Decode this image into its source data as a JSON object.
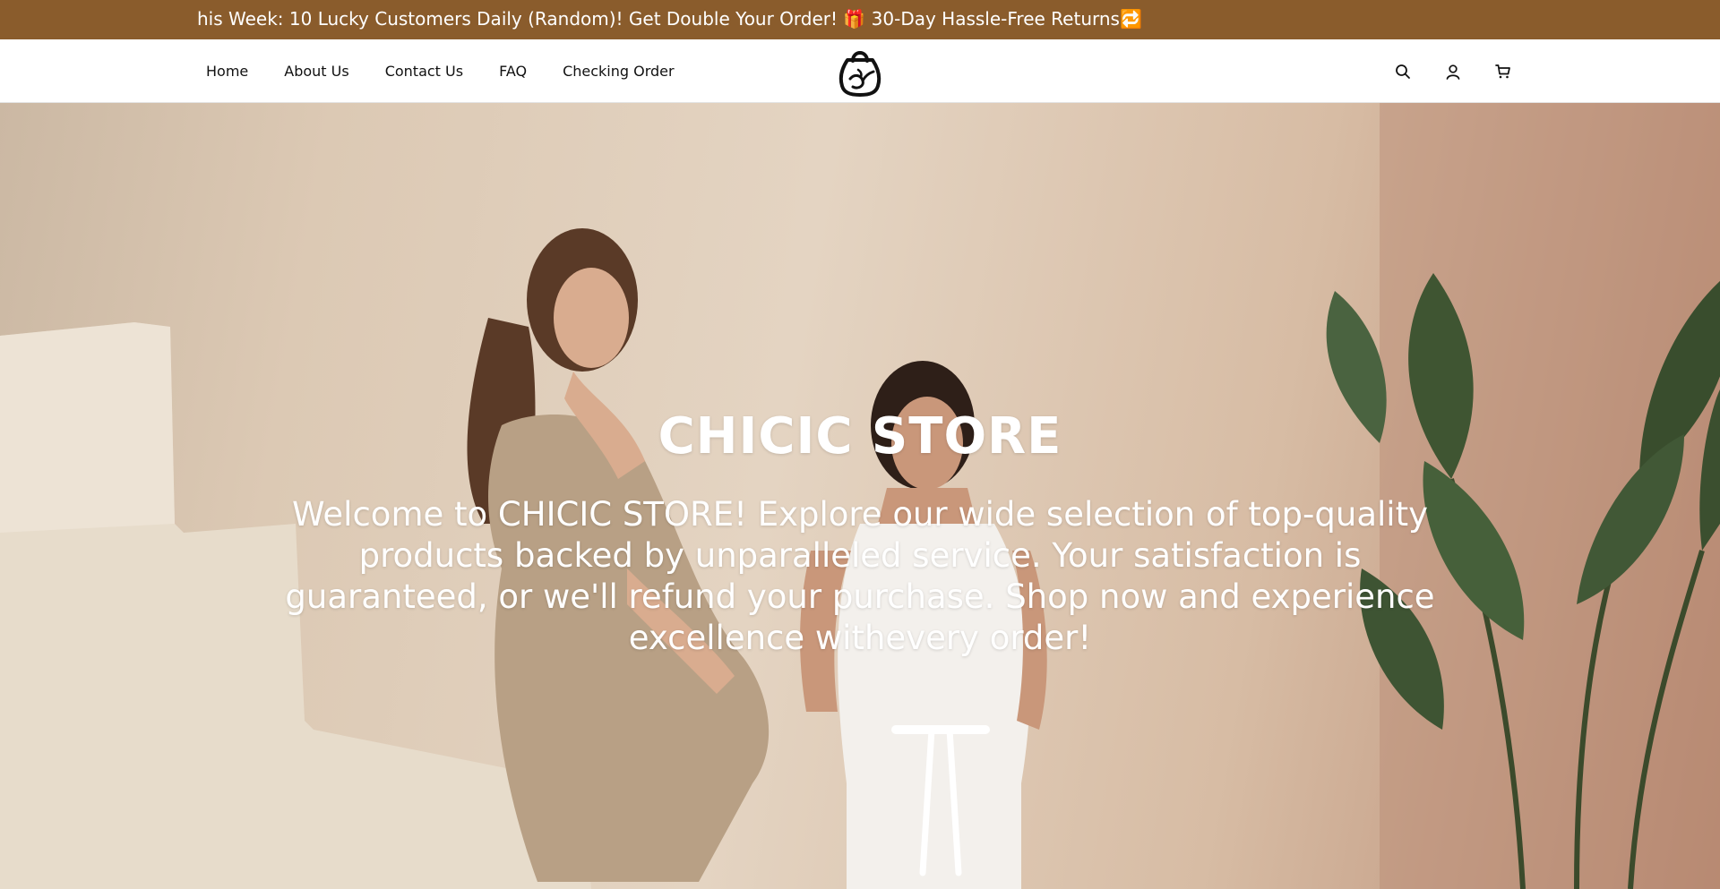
{
  "announcement": {
    "text": "his Week: 10 Lucky Customers Daily (Random)! Get Double Your Order! 🎁 30-Day Hassle-Free Returns🔁"
  },
  "nav": {
    "items": [
      {
        "label": "Home"
      },
      {
        "label": "About Us"
      },
      {
        "label": "Contact Us"
      },
      {
        "label": "FAQ"
      },
      {
        "label": "Checking Order"
      }
    ]
  },
  "header": {
    "icons": [
      "search-icon",
      "account-icon",
      "cart-icon"
    ]
  },
  "hero": {
    "title": "CHICIC STORE",
    "text": "Welcome to CHICIC STORE! Explore our wide selection of top-quality products backed by unparalleled service. Your satisfaction is guaranteed, or we'll refund your purchase. Shop now and experience excellence withevery order!"
  },
  "colors": {
    "announcement_bg": "#8a5c2c",
    "header_bg": "#ffffff",
    "hero_text": "#ffffff"
  }
}
